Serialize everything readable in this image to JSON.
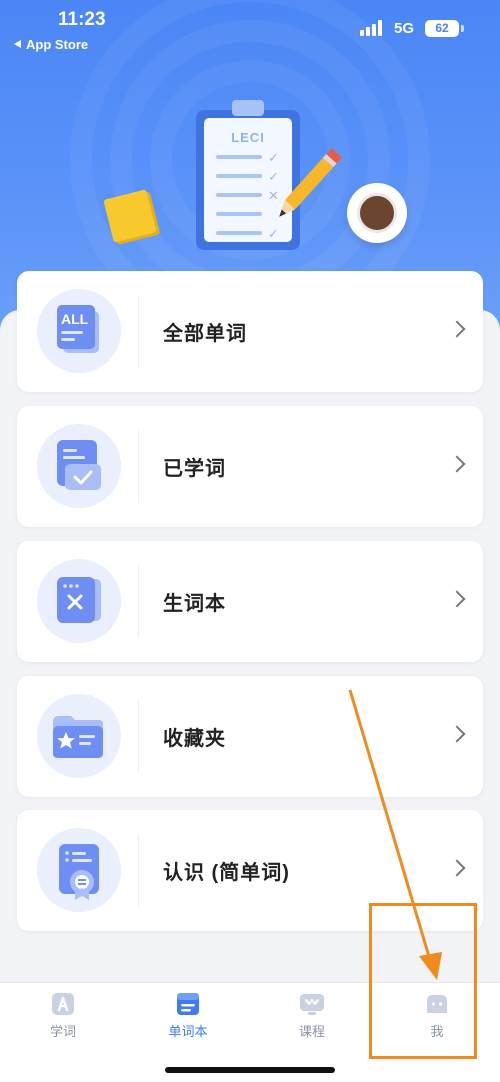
{
  "status_bar": {
    "time": "11:23",
    "back_app": "App Store",
    "network": "5G",
    "battery": "62"
  },
  "hero": {
    "clipboard_title": "LECI",
    "check_marks": [
      "✓",
      "✓",
      "✕",
      "",
      "✓"
    ]
  },
  "menu": [
    {
      "label": "全部单词",
      "icon": "all-words-icon",
      "icon_text": "ALL"
    },
    {
      "label": "已学词",
      "icon": "learned-words-icon",
      "icon_text": ""
    },
    {
      "label": "生词本",
      "icon": "new-words-icon",
      "icon_text": ""
    },
    {
      "label": "收藏夹",
      "icon": "favorites-icon",
      "icon_text": ""
    },
    {
      "label": "认识 (简单词)",
      "icon": "known-words-icon",
      "icon_text": ""
    }
  ],
  "tabbar": {
    "tabs": [
      {
        "label": "学词",
        "icon": "learn-icon",
        "active": false
      },
      {
        "label": "单词本",
        "icon": "wordbook-icon",
        "active": true
      },
      {
        "label": "课程",
        "icon": "course-icon",
        "active": false
      },
      {
        "label": "我",
        "icon": "profile-icon",
        "active": false
      }
    ]
  },
  "colors": {
    "primary": "#4a86f6",
    "active_tab": "#3c7bf0",
    "annotation": "#f18a1c",
    "icon_fill": "#6f8ef3",
    "icon_bg": "#e9effc"
  }
}
